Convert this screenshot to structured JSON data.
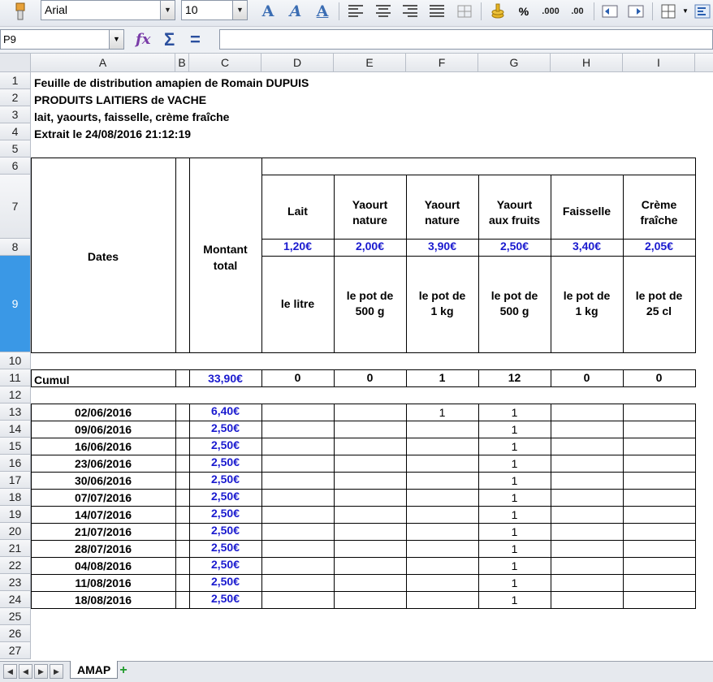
{
  "toolbar": {
    "font_name": "Arial",
    "font_size": "10",
    "percent_label": "%",
    "add_decimal_label": ".000",
    "del_decimal_label": ".00"
  },
  "formula_bar": {
    "name_box": "P9",
    "content": ""
  },
  "sheet": {
    "columns": [
      "A",
      "B",
      "C",
      "D",
      "E",
      "F",
      "G",
      "H",
      "I"
    ],
    "rows": [
      "1",
      "2",
      "3",
      "4",
      "5",
      "6",
      "7",
      "8",
      "9",
      "10",
      "11",
      "12",
      "13",
      "14",
      "15",
      "16",
      "17",
      "18",
      "19",
      "20",
      "21",
      "22",
      "23",
      "24",
      "25",
      "26",
      "27"
    ],
    "title_lines": [
      "Feuille de distribution amapien de Romain DUPUIS",
      "PRODUITS LAITIERS de VACHE",
      "lait, yaourts, faisselle, crème fraîche",
      "Extrait le 24/08/2016 21:12:19"
    ],
    "header": {
      "dates": "Dates",
      "montant_line1": "Montant",
      "montant_line2": "total",
      "products": [
        {
          "l1": "Lait",
          "l2": "",
          "price": "1,20€",
          "u1": "le litre",
          "u2": ""
        },
        {
          "l1": "Yaourt",
          "l2": "nature",
          "price": "2,00€",
          "u1": "le pot de",
          "u2": "500 g"
        },
        {
          "l1": "Yaourt",
          "l2": "nature",
          "price": "3,90€",
          "u1": "le pot de",
          "u2": "1 kg"
        },
        {
          "l1": "Yaourt",
          "l2": "aux fruits",
          "price": "2,50€",
          "u1": "le pot de",
          "u2": "500 g"
        },
        {
          "l1": "Faisselle",
          "l2": "",
          "price": "3,40€",
          "u1": "le pot de",
          "u2": "1 kg"
        },
        {
          "l1": "Crème",
          "l2": "fraîche",
          "price": "2,05€",
          "u1": "le pot de",
          "u2": "25 cl"
        }
      ]
    },
    "cumul": {
      "label": "Cumul",
      "total": "33,90€",
      "values": [
        "0",
        "0",
        "1",
        "12",
        "0",
        "0"
      ]
    },
    "entries": [
      {
        "date": "02/06/2016",
        "total": "6,40€",
        "f": "1",
        "g": "1"
      },
      {
        "date": "09/06/2016",
        "total": "2,50€",
        "f": "",
        "g": "1"
      },
      {
        "date": "16/06/2016",
        "total": "2,50€",
        "f": "",
        "g": "1"
      },
      {
        "date": "23/06/2016",
        "total": "2,50€",
        "f": "",
        "g": "1"
      },
      {
        "date": "30/06/2016",
        "total": "2,50€",
        "f": "",
        "g": "1"
      },
      {
        "date": "07/07/2016",
        "total": "2,50€",
        "f": "",
        "g": "1"
      },
      {
        "date": "14/07/2016",
        "total": "2,50€",
        "f": "",
        "g": "1"
      },
      {
        "date": "21/07/2016",
        "total": "2,50€",
        "f": "",
        "g": "1"
      },
      {
        "date": "28/07/2016",
        "total": "2,50€",
        "f": "",
        "g": "1"
      },
      {
        "date": "04/08/2016",
        "total": "2,50€",
        "f": "",
        "g": "1"
      },
      {
        "date": "11/08/2016",
        "total": "2,50€",
        "f": "",
        "g": "1"
      },
      {
        "date": "18/08/2016",
        "total": "2,50€",
        "f": "",
        "g": "1"
      }
    ]
  },
  "tabs": {
    "sheet_name": "AMAP",
    "add_label": "+"
  }
}
